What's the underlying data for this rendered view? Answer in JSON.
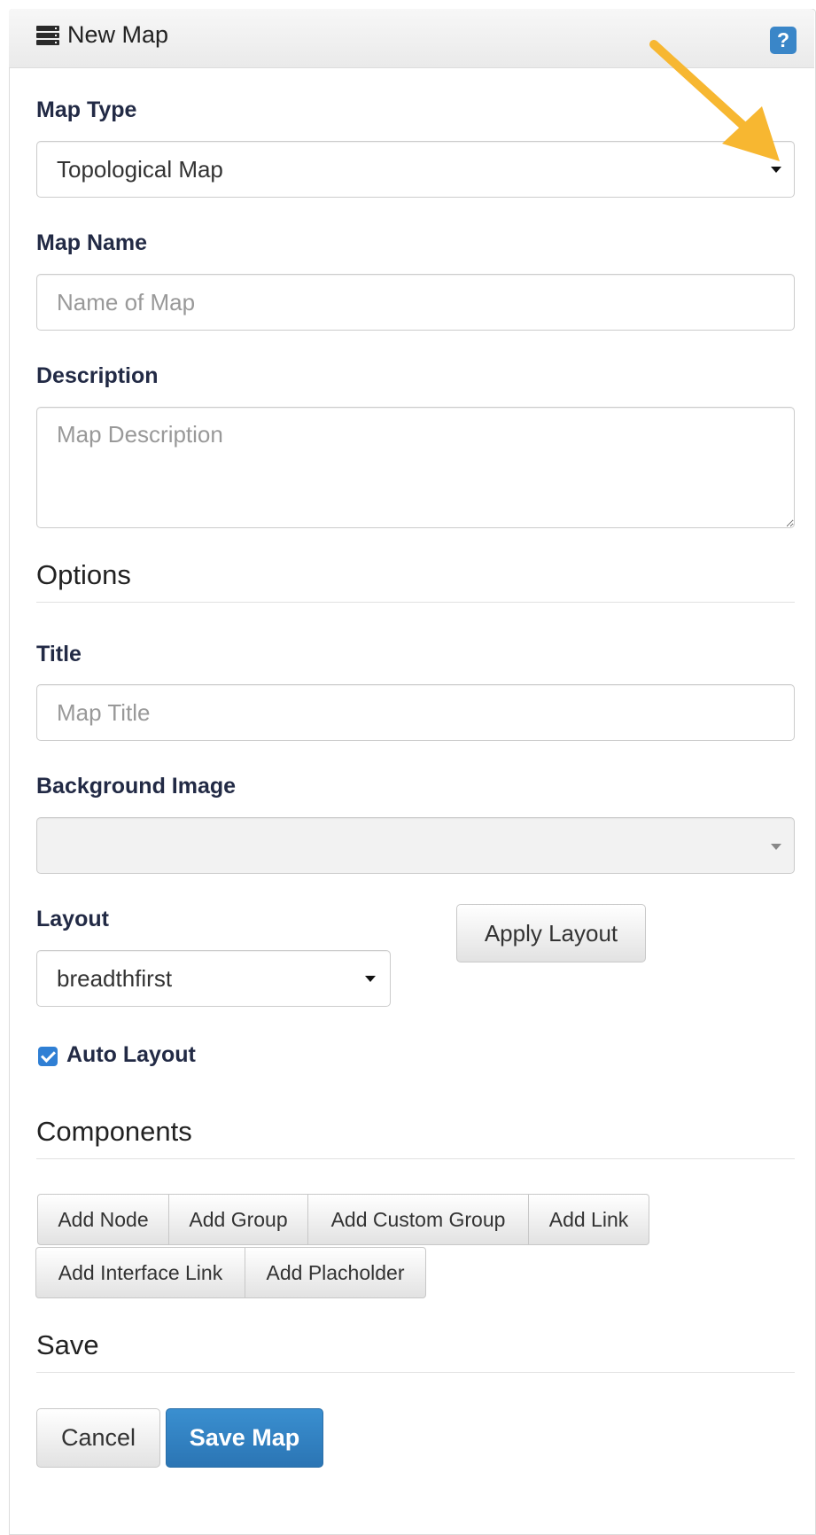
{
  "header": {
    "title": "New Map",
    "help_label": "?"
  },
  "map_type": {
    "label": "Map Type",
    "value": "Topological Map"
  },
  "map_name": {
    "label": "Map Name",
    "placeholder": "Name of Map"
  },
  "description": {
    "label": "Description",
    "placeholder": "Map Description"
  },
  "options": {
    "heading": "Options",
    "title_label": "Title",
    "title_placeholder": "Map Title",
    "background_label": "Background Image",
    "background_value": "",
    "layout_label": "Layout",
    "layout_value": "breadthfirst",
    "apply_layout_label": "Apply Layout",
    "auto_layout_label": "Auto Layout",
    "auto_layout_checked": true
  },
  "components": {
    "heading": "Components",
    "buttons": [
      "Add Node",
      "Add Group",
      "Add Custom Group",
      "Add Link",
      "Add Interface Link",
      "Add Placholder"
    ]
  },
  "save": {
    "heading": "Save",
    "cancel_label": "Cancel",
    "save_label": "Save Map"
  },
  "colors": {
    "primary": "#2b7bbf",
    "help": "#3a86c8",
    "arrow": "#f7b731",
    "label": "#222a45"
  }
}
